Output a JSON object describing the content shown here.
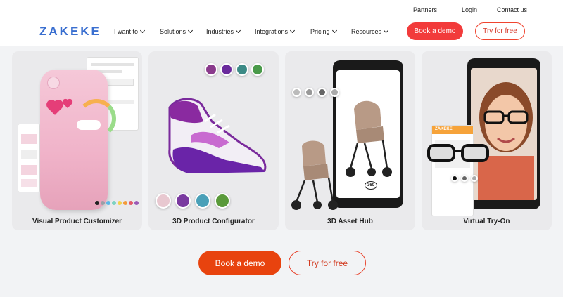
{
  "header": {
    "logo": "ZAKEKE",
    "top_links": [
      "Partners",
      "Login",
      "Contact us"
    ],
    "nav": [
      "I want to",
      "Solutions",
      "Industries",
      "Integrations",
      "Pricing",
      "Resources"
    ],
    "book_demo": "Book a demo",
    "try_free": "Try for free"
  },
  "cards": [
    {
      "label": "Visual Product Customizer",
      "swatch_colors": [
        "#222222",
        "#9aa0a6",
        "#5ab7e8",
        "#7ed3c2",
        "#f3d24a",
        "#f39a3a",
        "#e35b6a",
        "#9b59b6"
      ]
    },
    {
      "label": "3D Product Configurator"
    },
    {
      "label": "3D Asset Hub",
      "badge": "360"
    },
    {
      "label": "Virtual Try-On",
      "brand": "ZAKEKE"
    }
  ],
  "cta": {
    "book_demo": "Book a demo",
    "try_free": "Try for free"
  },
  "colors": {
    "accent_red": "#f23b3b",
    "accent_orange": "#e8430e",
    "logo_blue": "#3a6fd0"
  }
}
